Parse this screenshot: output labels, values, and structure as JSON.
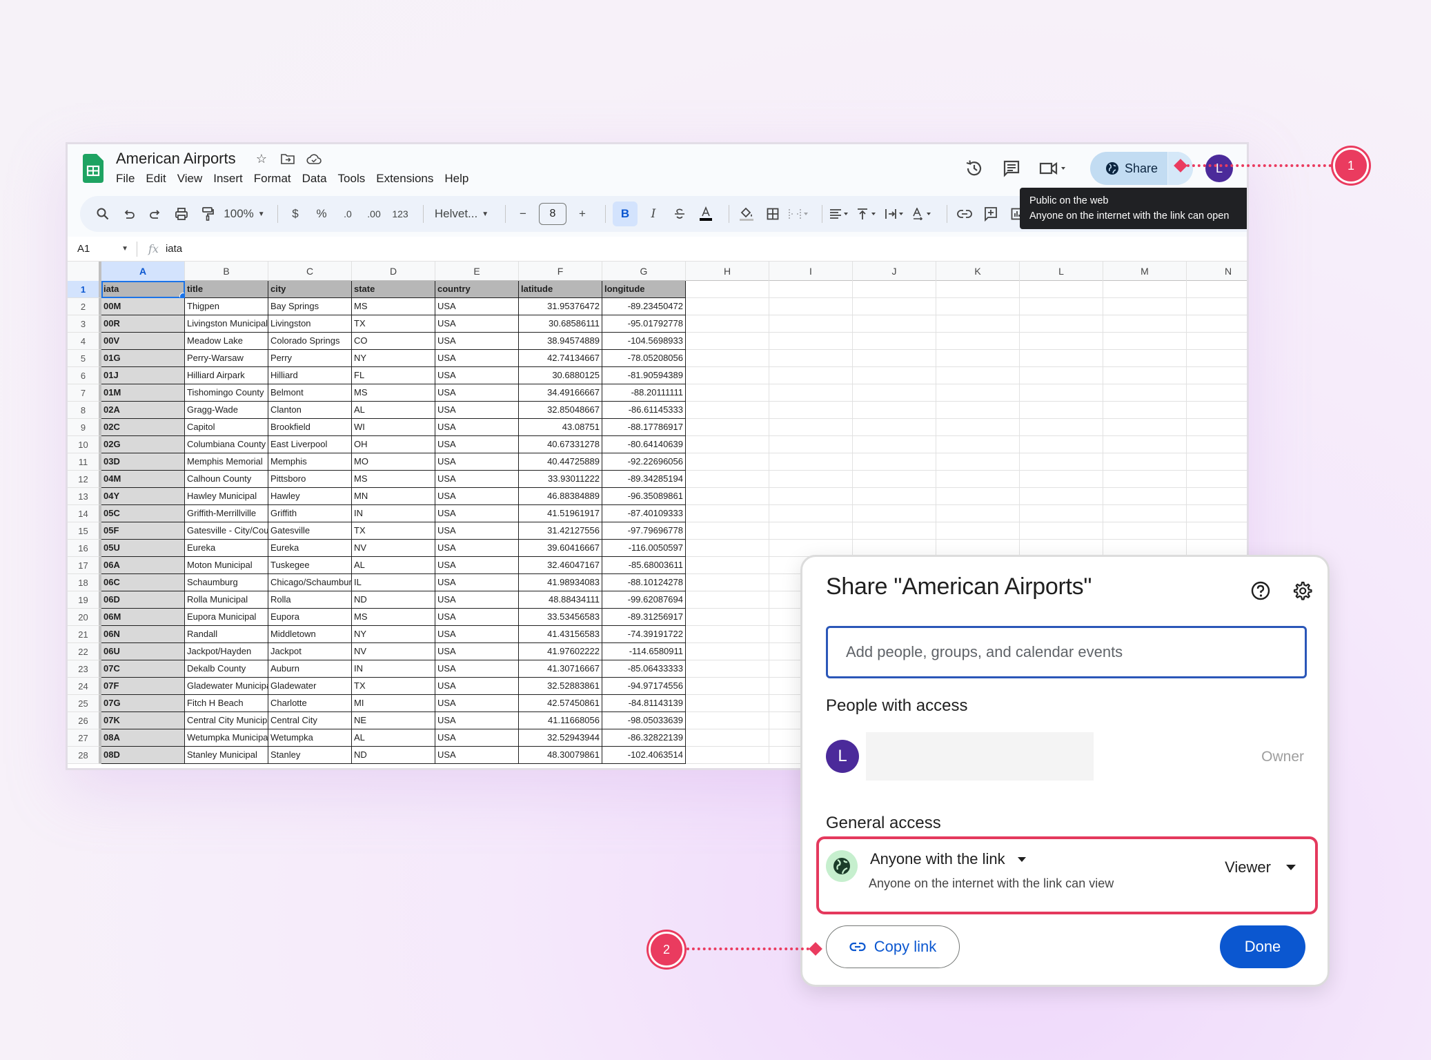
{
  "window": {
    "doc_title": "American Airports",
    "menu": [
      "File",
      "Edit",
      "View",
      "Insert",
      "Format",
      "Data",
      "Tools",
      "Extensions",
      "Help"
    ],
    "share_label": "Share",
    "avatar_initial": "L"
  },
  "toolbar": {
    "zoom": "100%",
    "currency": "$",
    "percent": "%",
    "decrease_decimal": ".0",
    "increase_decimal": ".00",
    "number_format": "123",
    "font": "Helvet...",
    "font_size": "8",
    "bold": "B",
    "italic": "I"
  },
  "tooltip": {
    "line1": "Public on the web",
    "line2": "Anyone on the internet with the link can open"
  },
  "formula_bar": {
    "cell_ref": "A1",
    "fx": "fx",
    "value": "iata"
  },
  "grid": {
    "columns": [
      "A",
      "B",
      "C",
      "D",
      "E",
      "F",
      "G",
      "H",
      "I",
      "J",
      "K",
      "L",
      "M",
      "N"
    ],
    "header": [
      "iata",
      "title",
      "city",
      "state",
      "country",
      "latitude",
      "longitude"
    ],
    "rows": [
      [
        "00M",
        "Thigpen",
        "Bay Springs",
        "MS",
        "USA",
        "31.95376472",
        "-89.23450472"
      ],
      [
        "00R",
        "Livingston Municipal",
        "Livingston",
        "TX",
        "USA",
        "30.68586111",
        "-95.01792778"
      ],
      [
        "00V",
        "Meadow Lake",
        "Colorado Springs",
        "CO",
        "USA",
        "38.94574889",
        "-104.5698933"
      ],
      [
        "01G",
        "Perry-Warsaw",
        "Perry",
        "NY",
        "USA",
        "42.74134667",
        "-78.05208056"
      ],
      [
        "01J",
        "Hilliard Airpark",
        "Hilliard",
        "FL",
        "USA",
        "30.6880125",
        "-81.90594389"
      ],
      [
        "01M",
        "Tishomingo County",
        "Belmont",
        "MS",
        "USA",
        "34.49166667",
        "-88.20111111"
      ],
      [
        "02A",
        "Gragg-Wade",
        "Clanton",
        "AL",
        "USA",
        "32.85048667",
        "-86.61145333"
      ],
      [
        "02C",
        "Capitol",
        "Brookfield",
        "WI",
        "USA",
        "43.08751",
        "-88.17786917"
      ],
      [
        "02G",
        "Columbiana County",
        "East Liverpool",
        "OH",
        "USA",
        "40.67331278",
        "-80.64140639"
      ],
      [
        "03D",
        "Memphis Memorial",
        "Memphis",
        "MO",
        "USA",
        "40.44725889",
        "-92.22696056"
      ],
      [
        "04M",
        "Calhoun County",
        "Pittsboro",
        "MS",
        "USA",
        "33.93011222",
        "-89.34285194"
      ],
      [
        "04Y",
        "Hawley Municipal",
        "Hawley",
        "MN",
        "USA",
        "46.88384889",
        "-96.35089861"
      ],
      [
        "05C",
        "Griffith-Merrillville",
        "Griffith",
        "IN",
        "USA",
        "41.51961917",
        "-87.40109333"
      ],
      [
        "05F",
        "Gatesville - City/County",
        "Gatesville",
        "TX",
        "USA",
        "31.42127556",
        "-97.79696778"
      ],
      [
        "05U",
        "Eureka",
        "Eureka",
        "NV",
        "USA",
        "39.60416667",
        "-116.0050597"
      ],
      [
        "06A",
        "Moton Municipal",
        "Tuskegee",
        "AL",
        "USA",
        "32.46047167",
        "-85.68003611"
      ],
      [
        "06C",
        "Schaumburg",
        "Chicago/Schaumburg",
        "IL",
        "USA",
        "41.98934083",
        "-88.10124278"
      ],
      [
        "06D",
        "Rolla Municipal",
        "Rolla",
        "ND",
        "USA",
        "48.88434111",
        "-99.62087694"
      ],
      [
        "06M",
        "Eupora Municipal",
        "Eupora",
        "MS",
        "USA",
        "33.53456583",
        "-89.31256917"
      ],
      [
        "06N",
        "Randall",
        "Middletown",
        "NY",
        "USA",
        "41.43156583",
        "-74.39191722"
      ],
      [
        "06U",
        "Jackpot/Hayden",
        "Jackpot",
        "NV",
        "USA",
        "41.97602222",
        "-114.6580911"
      ],
      [
        "07C",
        "Dekalb County",
        "Auburn",
        "IN",
        "USA",
        "41.30716667",
        "-85.06433333"
      ],
      [
        "07F",
        "Gladewater Municipal",
        "Gladewater",
        "TX",
        "USA",
        "32.52883861",
        "-94.97174556"
      ],
      [
        "07G",
        "Fitch H Beach",
        "Charlotte",
        "MI",
        "USA",
        "42.57450861",
        "-84.81143139"
      ],
      [
        "07K",
        "Central City Municipal",
        "Central City",
        "NE",
        "USA",
        "41.11668056",
        "-98.05033639"
      ],
      [
        "08A",
        "Wetumpka Municipal",
        "Wetumpka",
        "AL",
        "USA",
        "32.52943944",
        "-86.32822139"
      ],
      [
        "08D",
        "Stanley Municipal",
        "Stanley",
        "ND",
        "USA",
        "48.30079861",
        "-102.4063514"
      ]
    ]
  },
  "share_dialog": {
    "title": "Share \"American Airports\"",
    "input_placeholder": "Add people, groups, and calendar events",
    "people_label": "People with access",
    "owner_initial": "L",
    "owner_role": "Owner",
    "general_access_label": "General access",
    "access_type": "Anyone with the link",
    "access_description": "Anyone on the internet with the link can view",
    "role": "Viewer",
    "copy_link_label": "Copy link",
    "done_label": "Done"
  },
  "annotations": {
    "callout_1": "1",
    "callout_2": "2",
    "accent_color": "#ea3b5f"
  }
}
